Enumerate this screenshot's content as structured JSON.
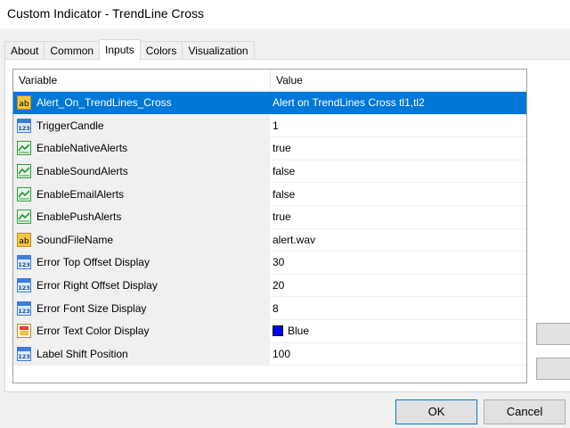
{
  "window": {
    "title": "Custom Indicator - TrendLine Cross"
  },
  "tabs": [
    {
      "label": "About",
      "active": false
    },
    {
      "label": "Common",
      "active": false
    },
    {
      "label": "Inputs",
      "active": true
    },
    {
      "label": "Colors",
      "active": false
    },
    {
      "label": "Visualization",
      "active": false
    }
  ],
  "grid": {
    "columns": [
      "Variable",
      "Value"
    ],
    "rows": [
      {
        "icon": "string-ab-icon",
        "variable": "Alert_On_TrendLines_Cross",
        "value": "Alert on TrendLines Cross tl1,tl2",
        "selected": true
      },
      {
        "icon": "integer-123-icon",
        "variable": "TriggerCandle",
        "value": "1"
      },
      {
        "icon": "boolean-toggle-icon",
        "variable": "EnableNativeAlerts",
        "value": "true"
      },
      {
        "icon": "boolean-toggle-icon",
        "variable": "EnableSoundAlerts",
        "value": "false"
      },
      {
        "icon": "boolean-toggle-icon",
        "variable": "EnableEmailAlerts",
        "value": "false"
      },
      {
        "icon": "boolean-toggle-icon",
        "variable": "EnablePushAlerts",
        "value": "true"
      },
      {
        "icon": "string-ab-icon",
        "variable": "SoundFileName",
        "value": "alert.wav"
      },
      {
        "icon": "integer-123-icon",
        "variable": "Error Top Offset Display",
        "value": "30"
      },
      {
        "icon": "integer-123-icon",
        "variable": "Error Right Offset Display",
        "value": "20"
      },
      {
        "icon": "integer-123-icon",
        "variable": "Error Font Size Display",
        "value": "8"
      },
      {
        "icon": "color-palette-icon",
        "variable": "Error Text Color Display",
        "value": "Blue",
        "swatch": "#0000ff"
      },
      {
        "icon": "integer-123-icon",
        "variable": "Label Shift Position",
        "value": "100"
      }
    ]
  },
  "buttons": {
    "ok": "OK",
    "cancel": "Cancel"
  },
  "colors": {
    "selection": "#0078d7",
    "string_icon": "#f5c542",
    "integer_icon": "#3b7ddd",
    "bool_icon": "#2e9e3e"
  }
}
